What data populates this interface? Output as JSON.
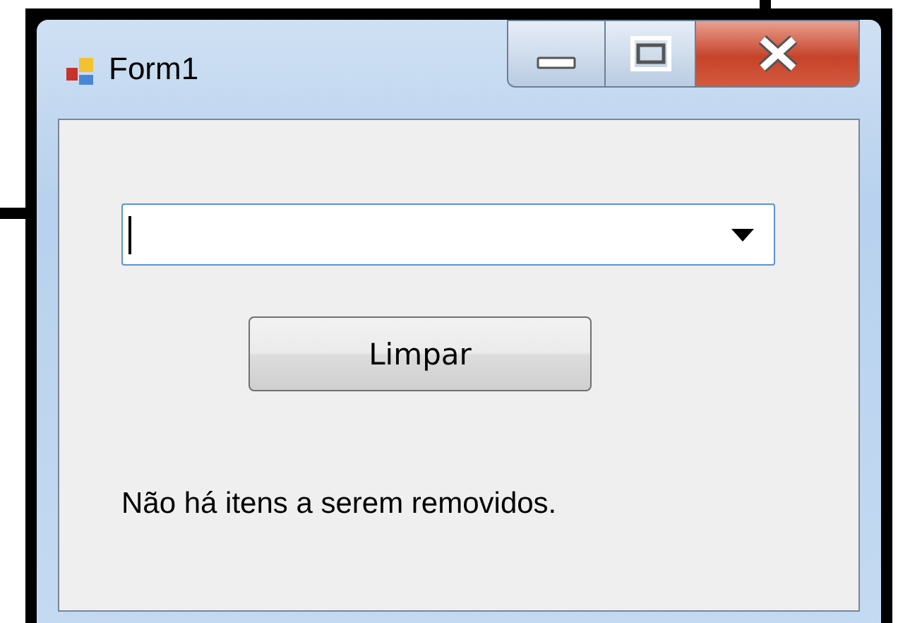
{
  "window": {
    "title": "Form1"
  },
  "combo": {
    "focused": true
  },
  "button": {
    "label": "Limpar"
  },
  "status_label": "Não há itens a serem removidos."
}
